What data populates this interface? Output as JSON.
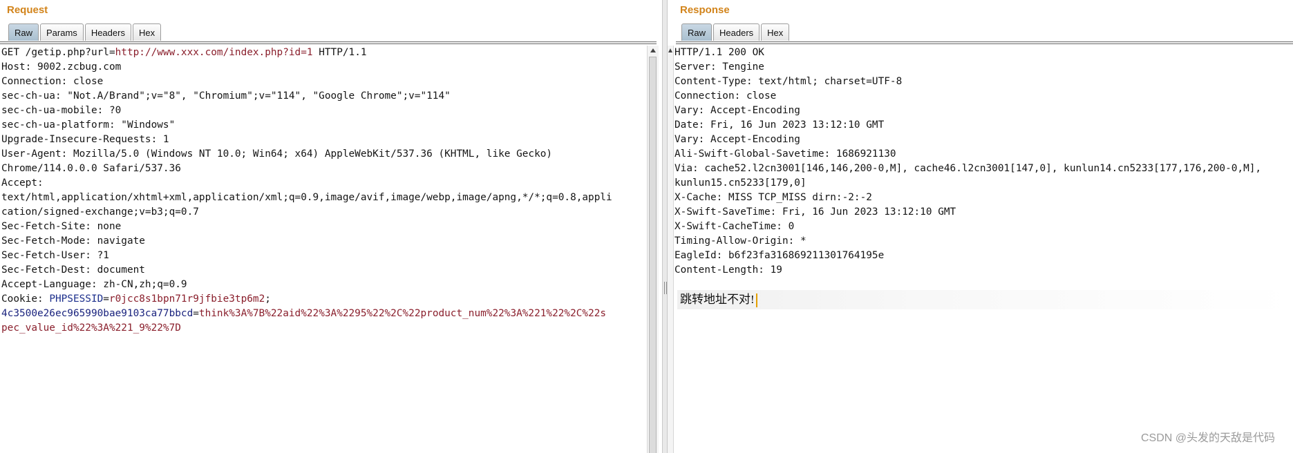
{
  "request": {
    "title": "Request",
    "tabs": [
      "Raw",
      "Params",
      "Headers",
      "Hex"
    ],
    "active_tab": "Raw",
    "lines": {
      "l1_method": "GET /getip.php?url=",
      "l1_url": "http://www.xxx.com/index.php?id=1",
      "l1_proto": " HTTP/1.1",
      "l2": "Host: 9002.zcbug.com",
      "l3": "Connection: close",
      "l4": "sec-ch-ua: \"Not.A/Brand\";v=\"8\", \"Chromium\";v=\"114\", \"Google Chrome\";v=\"114\"",
      "l5": "sec-ch-ua-mobile: ?0",
      "l6": "sec-ch-ua-platform: \"Windows\"",
      "l7": "Upgrade-Insecure-Requests: 1",
      "l8": "User-Agent: Mozilla/5.0 (Windows NT 10.0; Win64; x64) AppleWebKit/537.36 (KHTML, like Gecko)",
      "l9": "Chrome/114.0.0.0 Safari/537.36",
      "l10": "Accept:",
      "l11": "text/html,application/xhtml+xml,application/xml;q=0.9,image/avif,image/webp,image/apng,*/*;q=0.8,appli",
      "l12": "cation/signed-exchange;v=b3;q=0.7",
      "l13": "Sec-Fetch-Site: none",
      "l14": "Sec-Fetch-Mode: navigate",
      "l15": "Sec-Fetch-User: ?1",
      "l16": "Sec-Fetch-Dest: document",
      "l17": "Accept-Language: zh-CN,zh;q=0.9",
      "cookie_label": "Cookie: ",
      "cookie_name1": "PHPSESSID",
      "cookie_eq1": "=",
      "cookie_val1": "r0jcc8s1bpn71r9jfbie3tp6m2",
      "cookie_sep": ";",
      "cookie_name2": "4c3500e26ec965990bae9103ca77bbcd",
      "cookie_eq2": "=",
      "cookie_val2a": "think%3A%7B%22aid%22%3A%2295%22%2C%22product_num%22%3A%221%22%2C%22s",
      "cookie_val2b": "pec_value_id%22%3A%221_9%22%7D"
    }
  },
  "response": {
    "title": "Response",
    "tabs": [
      "Raw",
      "Headers",
      "Hex"
    ],
    "active_tab": "Raw",
    "lines": [
      "HTTP/1.1 200 OK",
      "Server: Tengine",
      "Content-Type: text/html; charset=UTF-8",
      "Connection: close",
      "Vary: Accept-Encoding",
      "Date: Fri, 16 Jun 2023 13:12:10 GMT",
      "Vary: Accept-Encoding",
      "Ali-Swift-Global-Savetime: 1686921130",
      "Via: cache52.l2cn3001[146,146,200-0,M], cache46.l2cn3001[147,0], kunlun14.cn5233[177,176,200-0,M],",
      "kunlun15.cn5233[179,0]",
      "X-Cache: MISS TCP_MISS dirn:-2:-2",
      "X-Swift-SaveTime: Fri, 16 Jun 2023 13:12:10 GMT",
      "X-Swift-CacheTime: 0",
      "Timing-Allow-Origin: *",
      "EagleId: b6f23fa316869211301764195e",
      "Content-Length: 19"
    ],
    "body": "跳转地址不对!"
  },
  "watermark": "CSDN @头发的天敌是代码"
}
